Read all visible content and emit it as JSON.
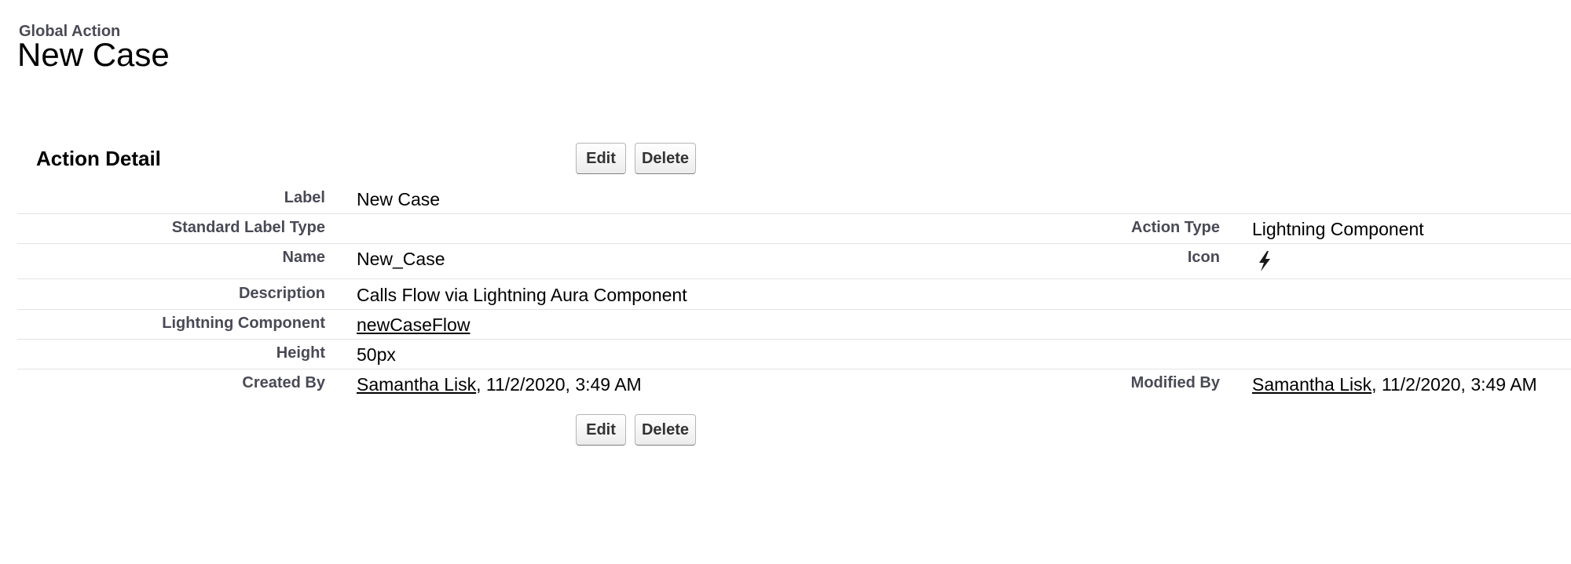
{
  "header": {
    "object_type": "Global Action",
    "title": "New Case"
  },
  "section": {
    "title": "Action Detail"
  },
  "buttons": {
    "edit_label": "Edit",
    "delete_label": "Delete"
  },
  "fields": {
    "label": {
      "name": "Label",
      "value": "New Case"
    },
    "standard_label_type": {
      "name": "Standard Label Type",
      "value": ""
    },
    "action_type": {
      "name": "Action Type",
      "value": "Lightning Component"
    },
    "api_name": {
      "name": "Name",
      "value": "New_Case"
    },
    "icon": {
      "name": "Icon",
      "icon": "lightning-bolt-icon"
    },
    "description": {
      "name": "Description",
      "value": "Calls Flow via Lightning Aura Component"
    },
    "lightning_component": {
      "name": "Lightning Component",
      "value": "newCaseFlow"
    },
    "height": {
      "name": "Height",
      "value": "50px"
    },
    "created_by": {
      "name": "Created By",
      "user": "Samantha Lisk",
      "date": ", 11/2/2020, 3:49 AM"
    },
    "modified_by": {
      "name": "Modified By",
      "user": "Samantha Lisk",
      "date": ", 11/2/2020, 3:49 AM"
    }
  },
  "colors": {
    "label_text": "#4a4a56",
    "row_divider": "#e0e3e5",
    "value_text": "#000000"
  }
}
